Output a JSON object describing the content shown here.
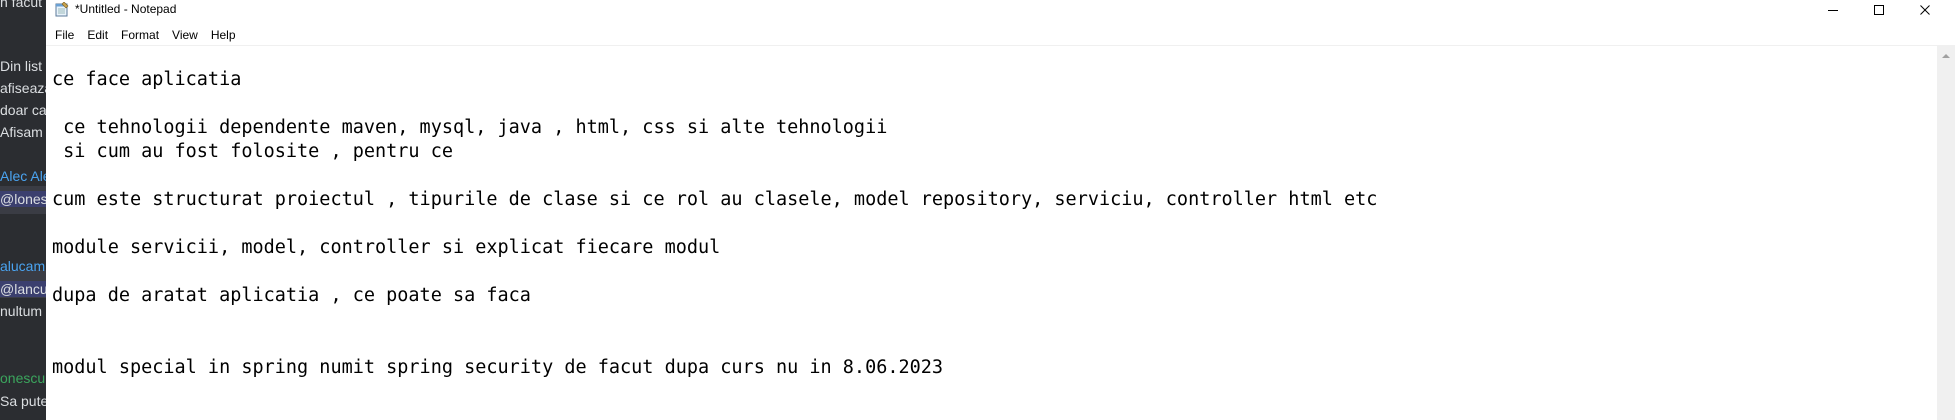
{
  "background_app": {
    "lines": [
      {
        "text": "n facut c",
        "style": "normal"
      },
      {
        "text": "Din list",
        "style": "normal"
      },
      {
        "text": "afiseaza",
        "style": "normal"
      },
      {
        "text": "doar car",
        "style": "normal"
      },
      {
        "text": "Afisam",
        "style": "normal"
      },
      {
        "text": "Alec Ale",
        "style": "link"
      },
      {
        "text": "@lones",
        "style": "highlight"
      },
      {
        "text": "alucam",
        "style": "link"
      },
      {
        "text": "@lancu",
        "style": "highlight"
      },
      {
        "text": "nultum",
        "style": "normal"
      },
      {
        "text": "onescu",
        "style": "green"
      },
      {
        "text": "Sa puter",
        "style": "normal"
      }
    ]
  },
  "window": {
    "title": "*Untitled - Notepad",
    "controls": {
      "minimize": "minimize-icon",
      "maximize": "maximize-icon",
      "close": "close-icon"
    }
  },
  "menu": {
    "items": [
      "File",
      "Edit",
      "Format",
      "View",
      "Help"
    ]
  },
  "editor": {
    "lines": [
      "ce face aplicatia",
      "",
      " ce tehnologii dependente maven, mysql, java , html, css si alte tehnologii",
      " si cum au fost folosite , pentru ce",
      "",
      "cum este structurat proiectul , tipurile de clase si ce rol au clasele, model repository, serviciu, controller html etc",
      "",
      "module servicii, model, controller si explicat fiecare modul",
      "",
      "dupa de aratat aplicatia , ce poate sa faca",
      "",
      "",
      "modul special in spring numit spring security de facut dupa curs nu in 8.06.2023"
    ]
  }
}
